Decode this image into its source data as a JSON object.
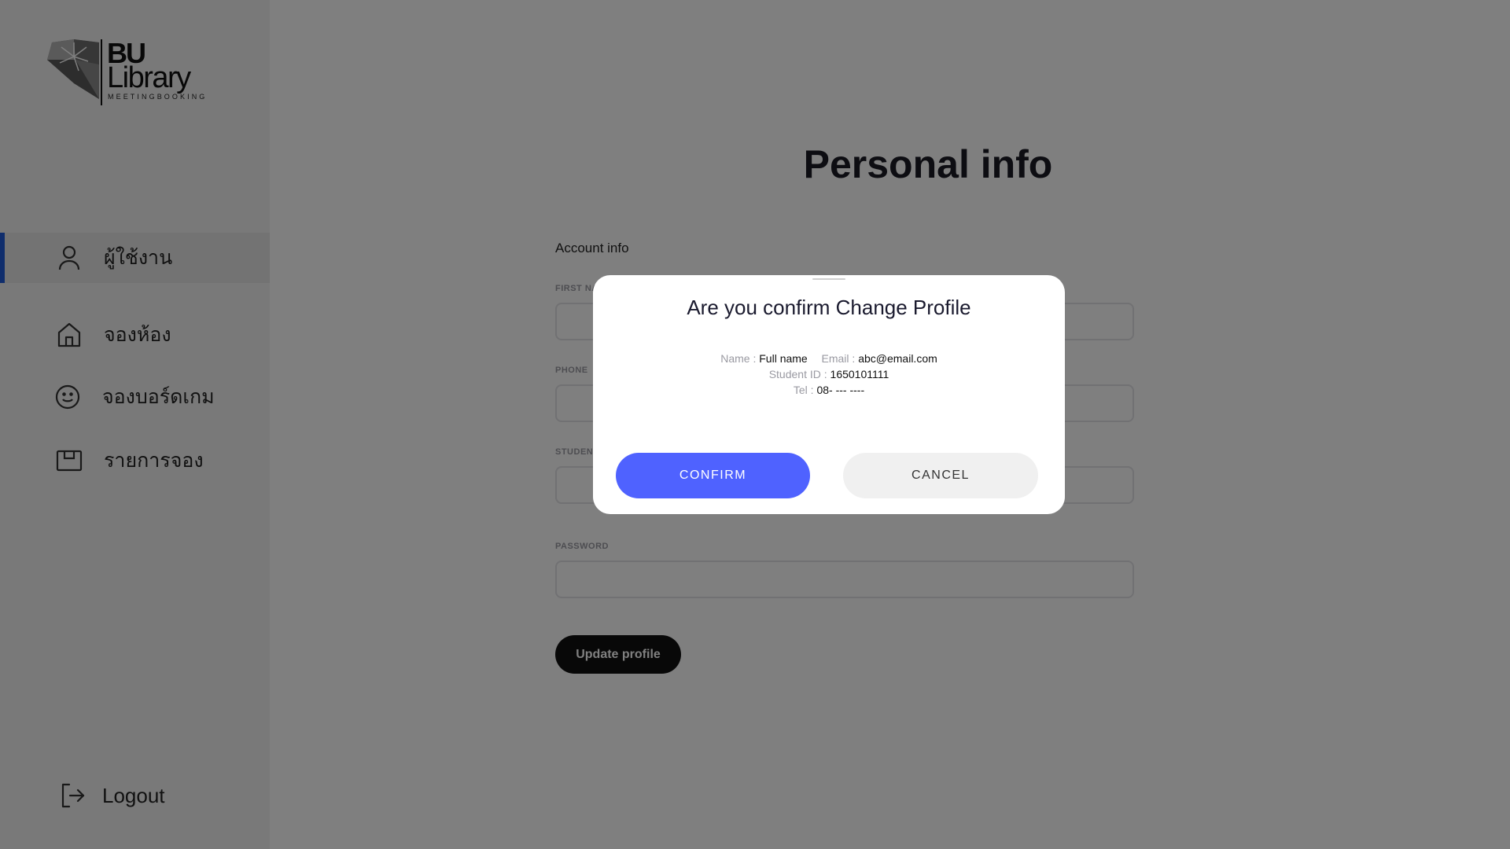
{
  "sidebar": {
    "logo": {
      "line1": "BU",
      "line2": "Library",
      "tagline": "MEETINGBOOKING"
    },
    "items": [
      {
        "label": "ผู้ใช้งาน",
        "icon": "user-icon",
        "active": true
      },
      {
        "label": "จองห้อง",
        "icon": "home-icon",
        "active": false
      },
      {
        "label": "จองบอร์ดเกม",
        "icon": "smile-icon",
        "active": false
      },
      {
        "label": "รายการจอง",
        "icon": "box-icon",
        "active": false
      }
    ],
    "logout": {
      "label": "Logout",
      "icon": "logout-icon"
    }
  },
  "main": {
    "title": "Personal info",
    "section": "Account info",
    "fields": {
      "first_name": {
        "label": "FIRST NAME"
      },
      "phone": {
        "label": "PHONE"
      },
      "student": {
        "label": "STUDENT ID"
      },
      "password": {
        "label": "PASSWORD"
      }
    },
    "update_button": "Update profile"
  },
  "modal": {
    "title": "Are you confirm Change Profile",
    "name_label": "Name :",
    "name_value": "Full name",
    "email_label": "Email :",
    "email_value": "abc@email.com",
    "student_label": "Student ID :",
    "student_value": "1650101111",
    "tel_label": "Tel :",
    "tel_value": "08- --- ----",
    "confirm_label": "CONFIRM",
    "cancel_label": "CANCEL"
  },
  "colors": {
    "accent": "#4f62ff",
    "active_indicator": "#1e5bd8",
    "overlay": "rgba(0,0,0,0.5)"
  }
}
